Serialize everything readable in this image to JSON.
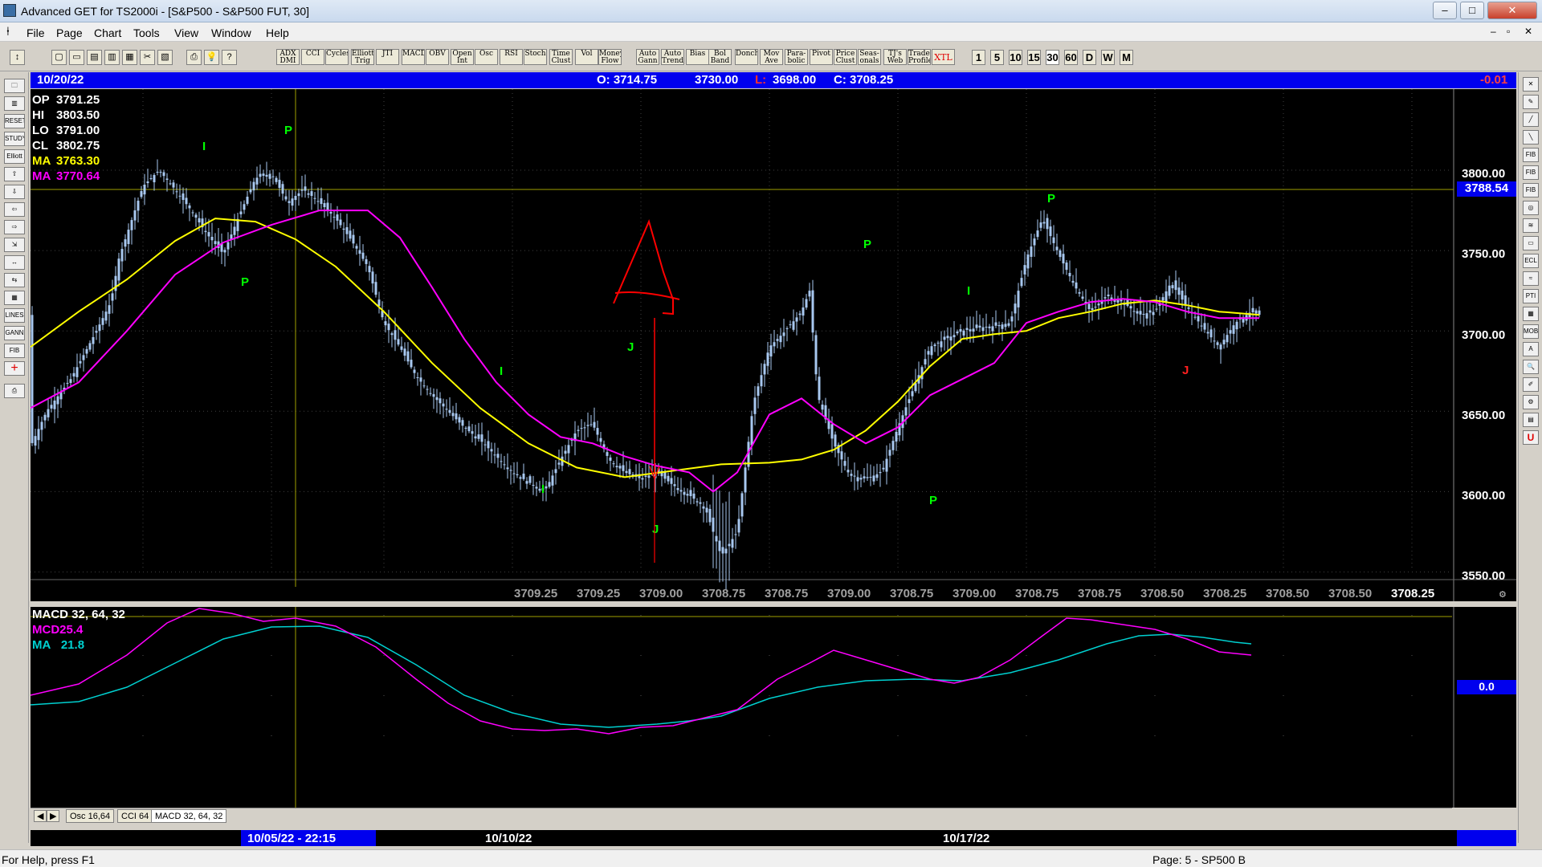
{
  "window": {
    "title": "Advanced GET for TS2000i - [S&P500 - S&P500 FUT, 30]",
    "min_label": "–",
    "max_label": "□",
    "close_label": "✕"
  },
  "menu": [
    "File",
    "Page",
    "Chart",
    "Tools",
    "View",
    "Window",
    "Help"
  ],
  "toolbar": {
    "indicators": [
      "ADX DMI",
      "CCI",
      "Cycles",
      "Elliott Trig",
      "JTI",
      "MACD",
      "OBV",
      "Open Int",
      "Osc",
      "RSI",
      "Stoch",
      "Time Clust",
      "Vol",
      "Money Flow",
      "Auto Gann",
      "Auto Trend",
      "Bias",
      "Bol Band",
      "Donch",
      "Mov Ave",
      "Para- bolic",
      "Pivot",
      "Price Clust",
      "Seas- onals",
      "TJ's Web",
      "Trade Profile",
      "XTL"
    ],
    "timeframes": [
      "1",
      "5",
      "10",
      "15",
      "30",
      "60",
      "D",
      "W",
      "M"
    ]
  },
  "header": {
    "date": "10/20/22",
    "open": "O: 3714.75",
    "high": "3730.00",
    "low_label": "L:",
    "low": "3698.00",
    "close": "C: 3708.25",
    "change": "-0.01"
  },
  "info_panel": [
    {
      "label": "OP",
      "value": "3791.25",
      "color": "#ffffff"
    },
    {
      "label": "HI",
      "value": "3803.50",
      "color": "#ffffff"
    },
    {
      "label": "LO",
      "value": "3791.00",
      "color": "#ffffff"
    },
    {
      "label": "CL",
      "value": "3802.75",
      "color": "#ffffff"
    },
    {
      "label": "MA",
      "value": "3763.30",
      "color": "#ffff00"
    },
    {
      "label": "MA",
      "value": "3770.64",
      "color": "#ff00ff"
    }
  ],
  "price_axis": {
    "labels": [
      "3800.00",
      "3750.00",
      "3700.00",
      "3650.00",
      "3600.00",
      "3550.00"
    ],
    "cursor_price": "3788.54",
    "last": "3708.25"
  },
  "bottom_values": [
    "3709.25",
    "3709.25",
    "3709.00",
    "3708.75",
    "3708.75",
    "3709.00",
    "3708.75",
    "3709.00",
    "3708.75",
    "3708.75",
    "3708.50",
    "3708.25",
    "3708.50",
    "3708.50"
  ],
  "macd": {
    "title": "MACD 32, 64, 32",
    "mcd_label": "MCD",
    "mcd_value": "25.4",
    "ma_label": "MA",
    "ma_value": "21.8",
    "zero": "0.0"
  },
  "tabs": [
    "Osc 16,64",
    "CCI 64",
    "MACD 32, 64, 32"
  ],
  "dates": {
    "cursor": "10/05/22 - 22:15",
    "d1": "10/10/22",
    "d2": "10/17/22"
  },
  "status": {
    "help": "For Help, press F1",
    "page": "Page: 5 - SP500 B"
  },
  "wave_labels": [
    {
      "t": "I",
      "c": "#00ff00"
    },
    {
      "t": "P",
      "c": "#00ff00"
    },
    {
      "t": "P",
      "c": "#00ff00"
    },
    {
      "t": "I",
      "c": "#00ff00"
    },
    {
      "t": "I",
      "c": "#00ff00"
    },
    {
      "t": "J",
      "c": "#00ff00"
    },
    {
      "t": "J",
      "c": "#00ff00"
    },
    {
      "t": "P",
      "c": "#00ff00"
    },
    {
      "t": "P",
      "c": "#00ff00"
    },
    {
      "t": "I",
      "c": "#00ff00"
    },
    {
      "t": "P",
      "c": "#00ff00"
    },
    {
      "t": "J",
      "c": "#ff2020"
    }
  ],
  "annotation": {
    "letter": "A",
    "color": "#ff0000"
  },
  "colors": {
    "candle": "#a8c8f0",
    "ma_yellow": "#ffff00",
    "ma_magenta": "#ff00ff",
    "macd_line": "#ff00ff",
    "signal_line": "#00d0d0",
    "cursor_line": "#a0a000",
    "grid": "#404040"
  }
}
